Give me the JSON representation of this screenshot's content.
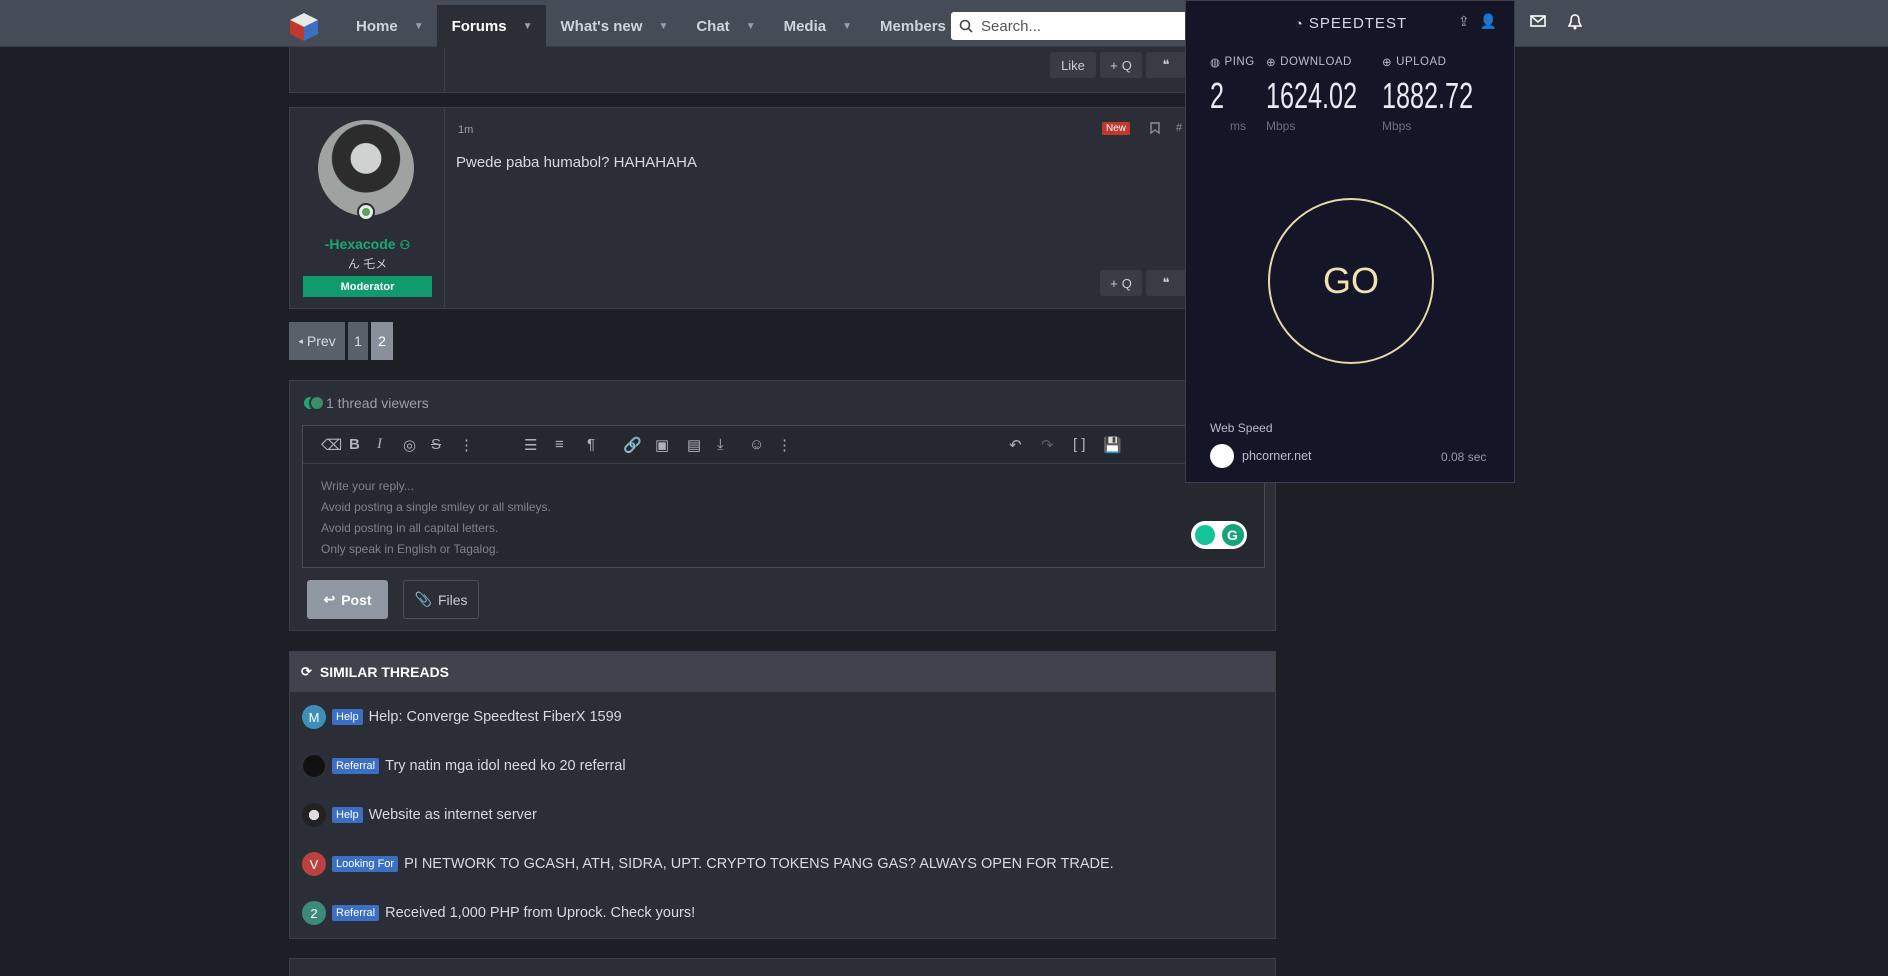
{
  "nav": {
    "items": [
      {
        "label": "Home"
      },
      {
        "label": "Forums"
      },
      {
        "label": "What's new"
      },
      {
        "label": "Chat"
      },
      {
        "label": "Media"
      },
      {
        "label": "Members"
      }
    ],
    "search_placeholder": "Search..."
  },
  "prev_post": {
    "like_label": "Like",
    "quote_label": "Q"
  },
  "post": {
    "time": "1m",
    "badge_new": "New",
    "number": "#",
    "text": "Pwede paba humabol? HAHAHAHA",
    "username": "-Hexacode",
    "user_title": "ん 乇メ",
    "user_role": "Moderator",
    "quote_label": "Q"
  },
  "pagination": {
    "prev": "Prev",
    "pages": [
      "1",
      "2"
    ],
    "current": "2"
  },
  "reply": {
    "viewers": "1 thread viewers",
    "placeholder_lines": [
      "Write your reply...",
      "Avoid posting a single smiley or all smileys.",
      "Avoid posting in all capital letters.",
      "Only speak in English or Tagalog."
    ],
    "post_button": "Post",
    "files_button": "Files"
  },
  "similar": {
    "heading": "SIMILAR THREADS",
    "threads": [
      {
        "avatar": "M",
        "avatar_color": "#3d8fb8",
        "prefix": "Help",
        "title": "Help: Converge Speedtest FiberX 1599"
      },
      {
        "avatar": "",
        "avatar_color": "#111111",
        "prefix": "Referral",
        "title": "Try natin mga idol need ko 20 referral"
      },
      {
        "avatar": "",
        "avatar_color": "#222222",
        "prefix": "Help",
        "title": "Website as internet server"
      },
      {
        "avatar": "V",
        "avatar_color": "#b8423d",
        "prefix": "Looking For",
        "title": "PI NETWORK TO GCASH, ATH, SIDRA, UPT. CRYPTO TOKENS PANG GAS? ALWAYS OPEN FOR TRADE."
      },
      {
        "avatar": "2",
        "avatar_color": "#3d8a7a",
        "prefix": "Referral",
        "title": "Received 1,000 PHP from Uprock. Check yours!"
      }
    ]
  },
  "speedtest": {
    "logo": "SPEEDTEST",
    "ping": {
      "label": "PING",
      "value": "2",
      "unit": "ms"
    },
    "download": {
      "label": "DOWNLOAD",
      "value": "1624.02",
      "unit": "Mbps"
    },
    "upload": {
      "label": "UPLOAD",
      "value": "1882.72",
      "unit": "Mbps"
    },
    "go_label": "GO",
    "web_speed_label": "Web Speed",
    "host": "phcorner.net",
    "time": "0.08 sec"
  }
}
